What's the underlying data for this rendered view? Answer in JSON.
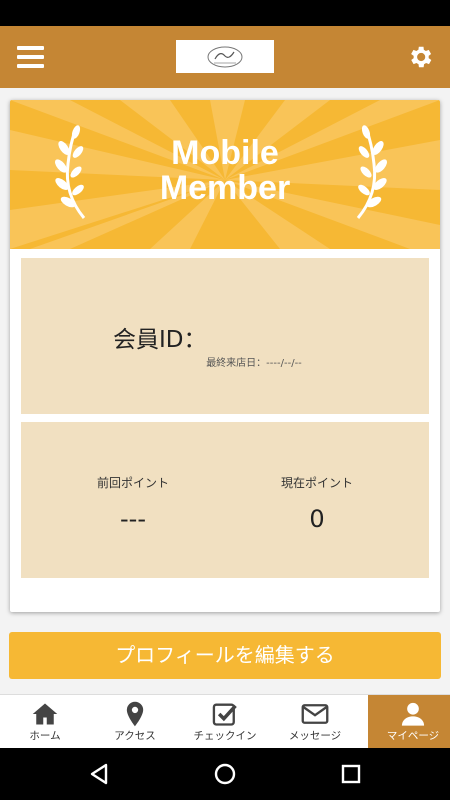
{
  "header": {
    "menu_icon": "hamburger-menu-icon",
    "settings_icon": "gear-icon",
    "brand_color": "#c58634"
  },
  "card": {
    "banner_title_line1": "Mobile",
    "banner_title_line2": "Member",
    "banner_color": "#f6b834",
    "member_id_label": "会員ID：",
    "last_visit": "最終来店日：----/--/--",
    "prev_points_label": "前回ポイント",
    "prev_points_value": "---",
    "current_points_label": "現在ポイント",
    "current_points_value": "0"
  },
  "edit_profile_label": "プロフィールを編集する",
  "tabs": [
    {
      "label": "ホーム",
      "icon": "home-icon"
    },
    {
      "label": "アクセス",
      "icon": "map-pin-icon"
    },
    {
      "label": "チェックイン",
      "icon": "checkin-icon"
    },
    {
      "label": "メッセージ",
      "icon": "mail-icon"
    },
    {
      "label": "マイページ",
      "icon": "user-icon",
      "active": true
    }
  ]
}
